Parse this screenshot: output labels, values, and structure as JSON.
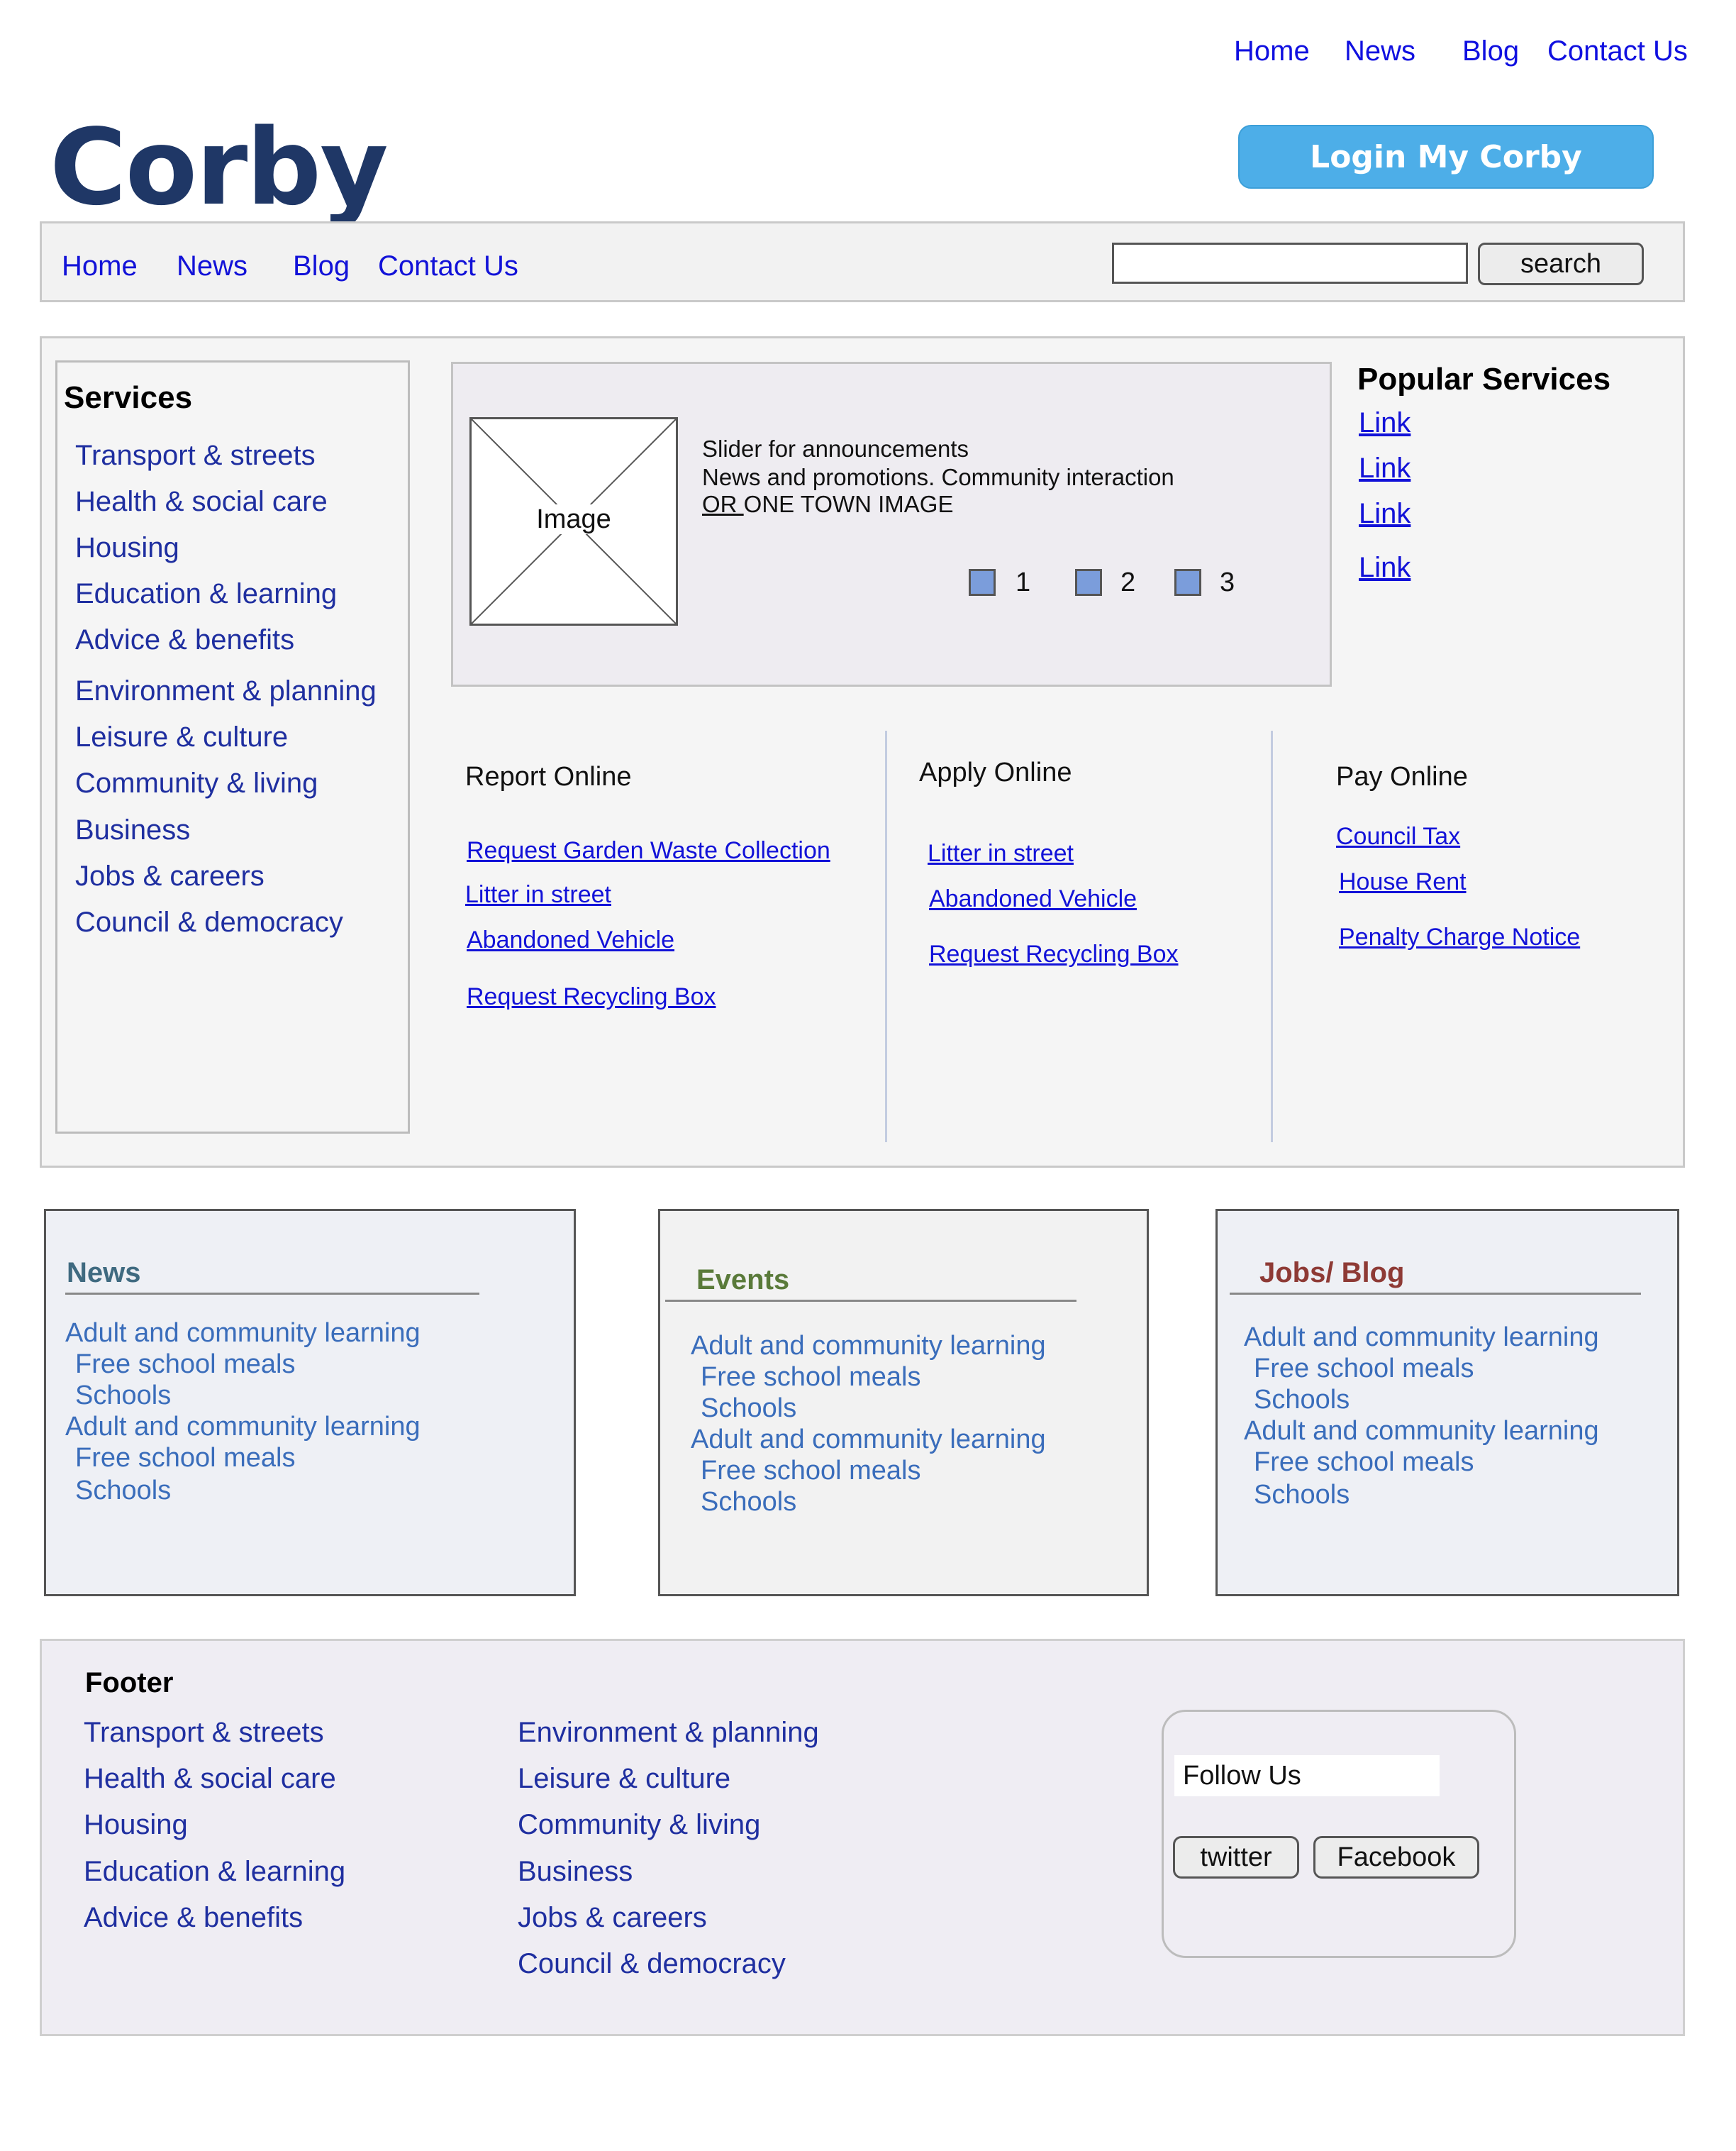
{
  "top_nav": [
    "Home",
    "News",
    "Blog",
    "Contact Us"
  ],
  "logo": "Corby",
  "login_label": "Login My Corby",
  "main_nav": [
    "Home",
    "News",
    "Blog",
    "Contact Us"
  ],
  "search": {
    "value": "",
    "button_label": "search"
  },
  "services": {
    "title": "Services",
    "items": [
      "Transport & streets",
      "Health & social care",
      "Housing",
      "Education & learning",
      "Advice & benefits",
      "Environment & planning",
      "Leisure & culture",
      "Community & living",
      "Business",
      "Jobs & careers",
      "Council & democracy"
    ]
  },
  "slider": {
    "image_label": "Image",
    "line1": "Slider for announcements",
    "line2": "News and promotions. Community interaction",
    "line3_or": "OR ",
    "line3_rest": " ONE TOWN IMAGE",
    "dots": [
      "1",
      "2",
      "3"
    ]
  },
  "popular": {
    "title": "Popular Services",
    "links": [
      "Link",
      "Link",
      "Link",
      "Link"
    ]
  },
  "report": {
    "title": "Report Online",
    "links": [
      "Request Garden Waste Collection",
      "Litter in street",
      "Abandoned Vehicle",
      "Request Recycling Box"
    ]
  },
  "apply": {
    "title": "Apply Online",
    "links": [
      "Litter in street",
      "Abandoned Vehicle",
      "Request Recycling Box"
    ]
  },
  "pay": {
    "title": "Pay Online",
    "links": [
      "Council Tax",
      "House Rent",
      "Penalty Charge Notice"
    ]
  },
  "cards": [
    {
      "title": "News",
      "color": "#3f6a80",
      "items": [
        "Adult and community learning",
        "Free school meals",
        "Schools",
        "Adult and community learning",
        "Free school meals",
        "Schools"
      ]
    },
    {
      "title": "Events",
      "color": "#5a7a3a",
      "items": [
        "Adult and community learning",
        "Free school meals",
        "Schools",
        "Adult and community learning",
        "Free school meals",
        "Schools"
      ]
    },
    {
      "title": "Jobs/ Blog",
      "color": "#8e3a35",
      "items": [
        "Adult and community learning",
        "Free school meals",
        "Schools",
        "Adult and community learning",
        "Free school meals",
        "Schools"
      ]
    }
  ],
  "footer": {
    "title": "Footer",
    "col1": [
      "Transport & streets",
      "Health & social care",
      "Housing",
      "Education & learning",
      "Advice & benefits"
    ],
    "col2": [
      "Environment & planning",
      "Leisure & culture",
      "Community & living",
      "Business",
      "Jobs & careers",
      "Council & democracy"
    ],
    "follow_label": "Follow Us",
    "twitter_label": "twitter",
    "facebook_label": "Facebook"
  },
  "colors": {
    "logo": "#1f3766",
    "login": "#4daee8",
    "link": "#1212d8",
    "service_link": "#1f2fa0",
    "card_link": "#3a6dbb"
  }
}
